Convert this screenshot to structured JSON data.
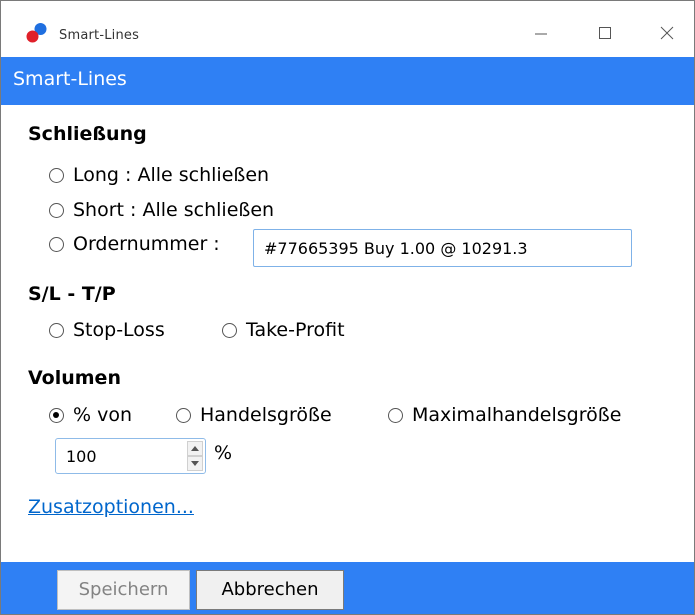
{
  "window": {
    "title": "Smart-Lines",
    "controls": [
      "minimize-icon",
      "maximize-icon",
      "close-icon"
    ]
  },
  "header": {
    "title": "Smart-Lines",
    "color": "#2f80f4"
  },
  "closing": {
    "title": "Schließung",
    "options": [
      {
        "label": "Long : Alle schließen",
        "checked": false
      },
      {
        "label": "Short : Alle schließen",
        "checked": false
      },
      {
        "label": "Ordernummer :",
        "checked": false
      }
    ],
    "order_value": "#77665395 Buy 1.00 @ 10291.3"
  },
  "sltp": {
    "title": "S/L - T/P",
    "options": [
      {
        "label": "Stop-Loss",
        "checked": false
      },
      {
        "label": "Take-Profit",
        "checked": false
      }
    ]
  },
  "volume": {
    "title": "Volumen",
    "options": [
      {
        "label": "% von",
        "checked": true
      },
      {
        "label": "Handelsgröße",
        "checked": false
      },
      {
        "label": "Maximalhandelsgröße",
        "checked": false
      }
    ],
    "value": "100",
    "unit": "%"
  },
  "extra_options_link": "Zusatzoptionen...",
  "footer": {
    "save_label": "Speichern",
    "save_enabled": false,
    "cancel_label": "Abbrechen"
  },
  "colors": {
    "accent": "#2f80f4",
    "link": "#0066cc"
  }
}
